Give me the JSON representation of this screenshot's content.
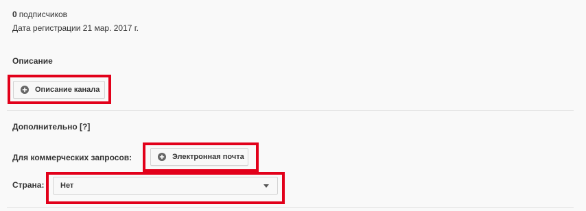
{
  "stats": {
    "subscribers_count": "0",
    "subscribers_label": "подписчиков",
    "registration_date": "Дата регистрации 21 мар. 2017 г."
  },
  "description": {
    "heading": "Описание",
    "button_label": "Описание канала",
    "button_icon": "plus-circle-icon"
  },
  "additional": {
    "heading": "Дополнительно",
    "help_link": "[?]",
    "business_label": "Для коммерческих запросов:",
    "email_button_label": "Электронная почта",
    "email_button_icon": "plus-circle-icon",
    "country_label": "Страна:",
    "country_value": "Нет",
    "dropdown_icon": "chevron-down-icon"
  },
  "colors": {
    "highlight": "#e2001a",
    "background": "#f9f9f9",
    "button_bg": "#f8f8f8",
    "text": "#333333"
  }
}
